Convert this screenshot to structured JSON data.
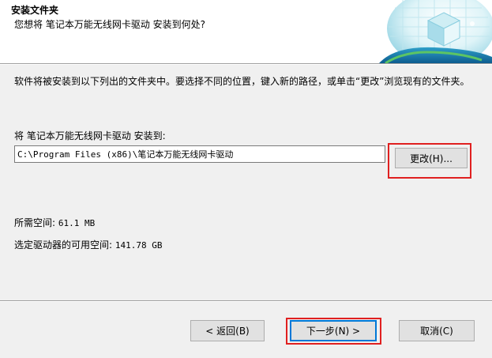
{
  "header": {
    "title": "安装文件夹",
    "subtitle": "您想将 笔记本万能无线网卡驱动 安装到何处?",
    "image_icon": "globe-cube-installer-icon"
  },
  "main": {
    "description": "软件将被安装到以下列出的文件夹中。要选择不同的位置，键入新的路径，或单击“更改”浏览现有的文件夹。",
    "destination_label": "将 笔记本万能无线网卡驱动 安装到:",
    "destination_path": "C:\\Program Files (x86)\\笔记本万能无线网卡驱动",
    "change_button": "更改(H)...",
    "space_required_label": "所需空间:",
    "space_required_value": "61.1 MB",
    "space_available_label": "选定驱动器的可用空间:",
    "space_available_value": "141.78 GB"
  },
  "footer": {
    "back_button": "< 返回(B)",
    "next_button": "下一步(N) >",
    "cancel_button": "取消(C)"
  },
  "colors": {
    "highlight": "#e02020",
    "default_button_border": "#0078d7",
    "dialog_bg": "#f0f0f0"
  }
}
